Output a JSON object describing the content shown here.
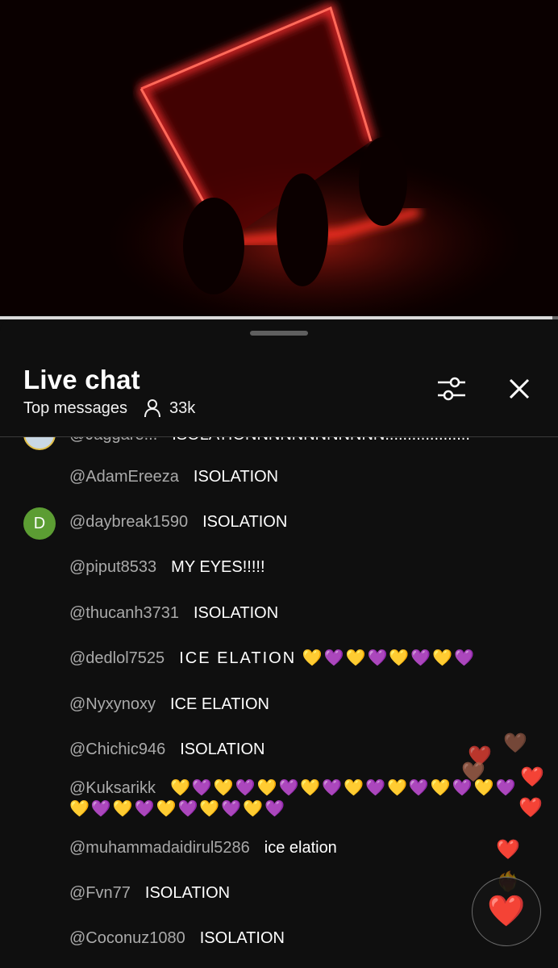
{
  "video": {
    "progress_fraction": 0.99
  },
  "chat": {
    "title": "Live chat",
    "mode_label": "Top messages",
    "viewer_count": "33k",
    "icons": {
      "filter": "filter-sliders-icon",
      "close": "close-icon",
      "viewers": "person-icon"
    }
  },
  "partial_message": {
    "author": "@Jaggare...",
    "text": "ISOLATIONNNNNNNNNNNN..................."
  },
  "messages": [
    {
      "author": "@AdamEreeza",
      "text": "ISOLATION"
    },
    {
      "author": "@daybreak1590",
      "text": "ISOLATION",
      "avatar_letter": "D",
      "avatar_color": "#5c9d33"
    },
    {
      "author": "@piput8533",
      "text": "MY EYES!!!!!"
    },
    {
      "author": "@thucanh3731",
      "text": "ISOLATION"
    },
    {
      "author": "@dedlol7525",
      "text": "ICE ELATION 💛💜💛💜💛💜💛💜"
    },
    {
      "author": "@Nyxynoxy",
      "text": "ICE ELATION"
    },
    {
      "author": "@Chichic946",
      "text": "ISOLATION"
    },
    {
      "author": "@Kuksarikk",
      "text": "💛💜💛💜💛💜💛💜💛💜💛💜💛💜💛💜💛💜💛💜💛💜💛💜💛💜"
    },
    {
      "author": "@muhammadaidirul5286",
      "text": "ice elation"
    },
    {
      "author": "@Fvn77",
      "text": "ISOLATION"
    },
    {
      "author": "@Coconuz1080",
      "text": "ISOLATION"
    }
  ],
  "reactions": {
    "button_emoji": "❤️",
    "floating": [
      "🤎",
      "❤️",
      "🤎",
      "❤️",
      "❤️",
      "❤️",
      "❤️‍🔥"
    ]
  }
}
